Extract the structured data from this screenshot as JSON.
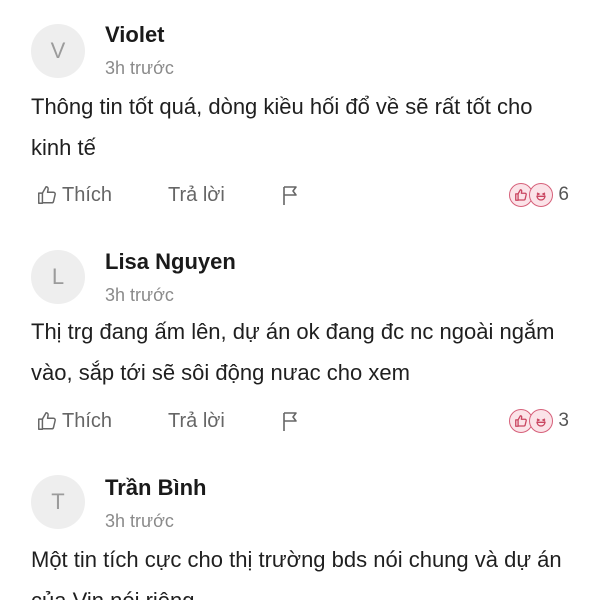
{
  "comments": [
    {
      "avatar_letter": "V",
      "name": "Violet",
      "time": "3h trước",
      "text": "Thông tin tốt quá, dòng kiều hối đổ về sẽ rất tốt cho kinh tế",
      "like_label": "Thích",
      "reply_label": "Trả lời",
      "reaction_count": "6"
    },
    {
      "avatar_letter": "L",
      "name": "Lisa Nguyen",
      "time": "3h trước",
      "text": "Thị trg đang ấm lên, dự án ok đang đc nc ngoài ngắm vào, sắp tới sẽ sôi động nưac cho xem",
      "like_label": "Thích",
      "reply_label": "Trả lời",
      "reaction_count": "3"
    },
    {
      "avatar_letter": "T",
      "name": "Trần Bình",
      "time": "3h trước",
      "text": "Một tin tích cực cho thị trường bds nói chung và dự án của Vin nói riêng"
    }
  ],
  "icons": {
    "like": "thumbs-up-icon",
    "flag": "flag-icon",
    "reaction_like": "like-reaction-icon",
    "reaction_haha": "haha-reaction-icon"
  },
  "colors": {
    "reaction_border": "#d6607a",
    "reaction_fill": "#fbe3e8",
    "avatar_bg": "#eeeeee"
  }
}
